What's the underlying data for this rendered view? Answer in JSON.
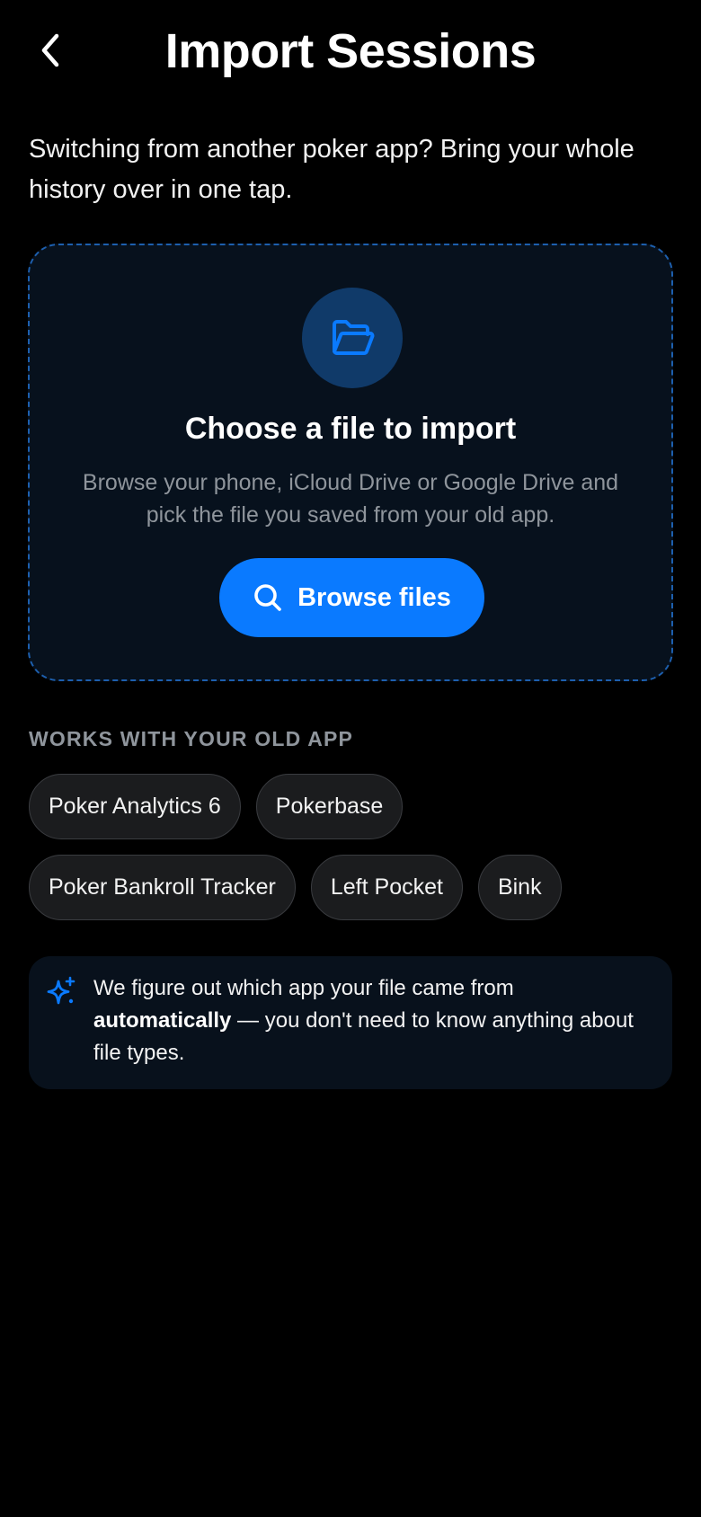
{
  "header": {
    "title": "Import Sessions",
    "back_icon": "chevron-left-icon"
  },
  "intro": {
    "text": "Switching from another poker app? Bring your whole history over in one tap."
  },
  "dropzone": {
    "icon": "folder-open-icon",
    "title": "Choose a file to import",
    "description": "Browse your phone, iCloud Drive or Google Drive and pick the file you saved from your old app.",
    "button_label": "Browse files",
    "button_icon": "search-icon"
  },
  "compatible": {
    "label": "WORKS WITH YOUR OLD APP",
    "apps": [
      "Poker Analytics 6",
      "Pokerbase",
      "Poker Bankroll Tracker",
      "Left Pocket",
      "Bink"
    ]
  },
  "info": {
    "icon": "sparkle-icon",
    "text_before": "We figure out which app your file came from ",
    "text_bold": "automatically",
    "text_after": " — you don't need to know anything about file types."
  },
  "colors": {
    "background": "#000000",
    "accent": "#0a7aff",
    "card": "#07111d",
    "chip": "#1b1c1e",
    "muted_text": "#8f959c"
  }
}
